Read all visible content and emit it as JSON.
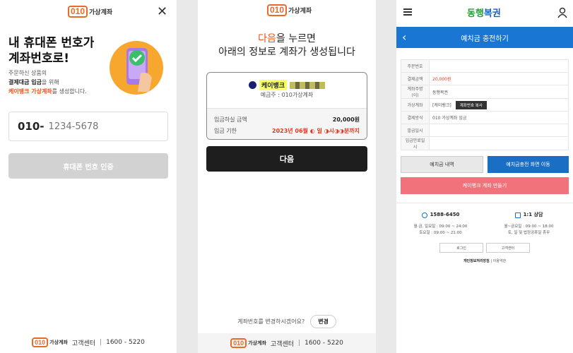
{
  "panel1": {
    "logo_badge": "010",
    "logo_text": "가상계좌",
    "title_line1": "내 휴대폰 번호가",
    "title_line2": "계좌번호로!",
    "desc_line1": "주문하신 상품의",
    "desc_line2_bold": "결제대금 입금",
    "desc_line2_rest": "을 위해",
    "desc_line3_highlight": "케이뱅크 가상계좌",
    "desc_line3_rest": "를 생성합니다.",
    "phone_prefix": "010-",
    "phone_placeholder": "1234-5678",
    "verify_button": "휴대폰 번호 인증",
    "footer_logo_badge": "010",
    "footer_logo_text": "가상계좌",
    "footer_center": "고객센터",
    "footer_phone": "1600 - 5220"
  },
  "panel2": {
    "logo_badge": "010",
    "logo_text": "가상계좌",
    "headline_highlight": "다음",
    "headline_rest": "을 누르면",
    "headline_line2": "아래의 정보로 계좌가 생성됩니다",
    "bank_name": "케이뱅크",
    "holder": "예금주 : 010가상계좌",
    "amount_label": "입금하실 금액",
    "amount_value": "20,000원",
    "deadline_label": "입금 기한",
    "deadline_value": "2023년 06월 ◐ 일 ◑시◑◑분까지",
    "next_button": "다음",
    "change_question": "계좌번호를 변경하시겠어요?",
    "change_button": "변경",
    "footer_logo_badge": "010",
    "footer_logo_text": "가상계좌",
    "footer_center": "고객센터",
    "footer_phone": "1600 - 5220"
  },
  "panel3": {
    "brand_left": "동행",
    "brand_right": "복권",
    "page_title": "예치금 충전하기",
    "rows": [
      {
        "label": "주문번호",
        "value": ""
      },
      {
        "label": "결제금액",
        "value": "20,000원"
      },
      {
        "label": "계좌주명(이)",
        "value": "동행복권"
      },
      {
        "label": "가상계좌",
        "value": "[케이뱅크]"
      },
      {
        "label": "결제방식",
        "value": "010 가상계좌 입금"
      },
      {
        "label": "발급일시",
        "value": ""
      },
      {
        "label": "입금만료일시",
        "value": ""
      }
    ],
    "copy_button": "계좌번호 복사",
    "history_button": "예치금 내역",
    "charge_page_button": "예치금충전 화면 이동",
    "kbank_button": "케이뱅크 계좌 만들기",
    "support_phone": "1588-6450",
    "support_phone_hours1": "월·금, 일요일 : 09:00 ~ 24:00",
    "support_phone_hours2": "토요일 : 09:00 ~ 21:00",
    "support_chat": "1:1 상담",
    "support_chat_hours1": "월~금요일 : 09:00 ~ 18:00",
    "support_chat_hours2": "토, 일 및 법정공휴일 휴무",
    "login_button": "로그인",
    "customer_center_button": "고객센터",
    "policy_bold": "개인정보처리방침",
    "policy_rest": "이용약관"
  }
}
